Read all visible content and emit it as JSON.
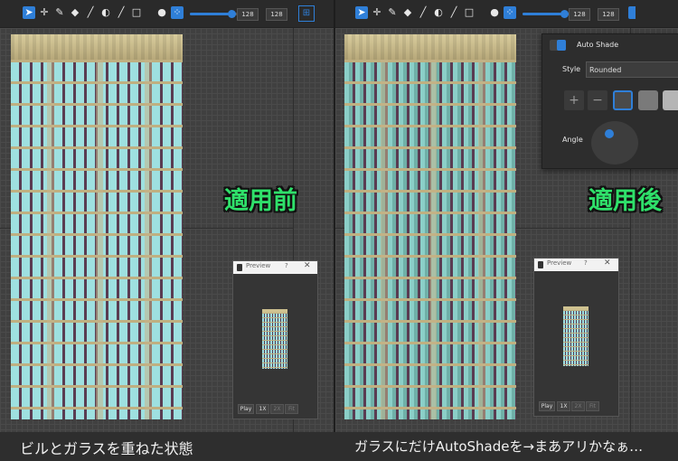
{
  "left_panel": {
    "toolbar": {
      "tools": [
        "select-arrow",
        "move-cross",
        "pencil",
        "eraser",
        "line",
        "paint-bucket",
        "brush",
        "rectangle-select"
      ],
      "brush_shape": "circle",
      "dither": "checker",
      "slider_percent": 0.85,
      "size_w": "128",
      "size_h": "128",
      "grid_toggle": "grid"
    },
    "label": "適用前",
    "preview": {
      "title": "Preview",
      "help": "?",
      "close": "✕",
      "buttons": [
        "Play",
        "1X",
        "2X",
        "Fit"
      ]
    }
  },
  "right_panel": {
    "toolbar": {
      "slider_percent": 0.85,
      "size_w": "128",
      "size_h": "128"
    },
    "label": "適用後",
    "preview": {
      "title": "Preview",
      "help": "?",
      "close": "✕",
      "buttons": [
        "Play",
        "1X",
        "2X",
        "Fit"
      ]
    },
    "auto_shade": {
      "title": "Auto Shade",
      "enabled": true,
      "style_label": "Style",
      "style_value": "Rounded",
      "add": "+",
      "remove": "−",
      "swatch_colors": [
        "#4a4a4a",
        "#7a7a7a",
        "#b5b5b5"
      ],
      "angle_label": "Angle"
    }
  },
  "captions": {
    "left": "ビルとガラスを重ねた状態",
    "right": "ガラスにだけAutoShadeを→まあアリかなぁ…"
  },
  "colors": {
    "accent": "#2f7fd8",
    "label_green": "#2fe06a",
    "glass": "#9ee0e0",
    "frame": "#5a3c52",
    "beam": "#bfb081"
  }
}
